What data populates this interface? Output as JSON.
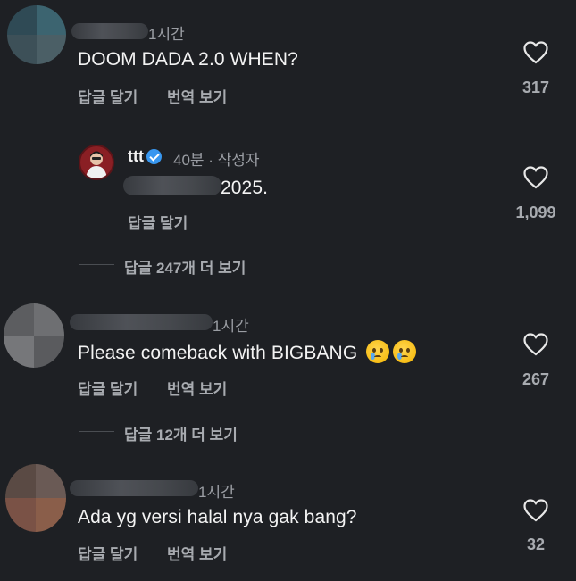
{
  "comments": [
    {
      "time": "1시간",
      "text": "DOOM DADA 2.0 WHEN?",
      "reply_label": "답글 달기",
      "translate_label": "번역 보기",
      "likes": "317"
    },
    {
      "username": "ttt",
      "time": "40분 · 작성자",
      "text": "2025.",
      "reply_label": "답글 달기",
      "likes": "1,099",
      "view_replies": "답글 247개 더 보기"
    },
    {
      "time": "1시간",
      "text": "Please comeback with BIGBANG",
      "emoji": "crying-face",
      "reply_label": "답글 달기",
      "translate_label": "번역 보기",
      "likes": "267",
      "view_replies": "답글 12개 더 보기"
    },
    {
      "time": "1시간",
      "text": "Ada yg versi halal nya gak bang?",
      "reply_label": "답글 달기",
      "translate_label": "번역 보기",
      "likes": "32"
    }
  ],
  "colors": {
    "background": "#1e2024",
    "primary_text": "#f3f3f3",
    "secondary_text": "#a8abb0",
    "verified_blue": "#3897f0"
  }
}
